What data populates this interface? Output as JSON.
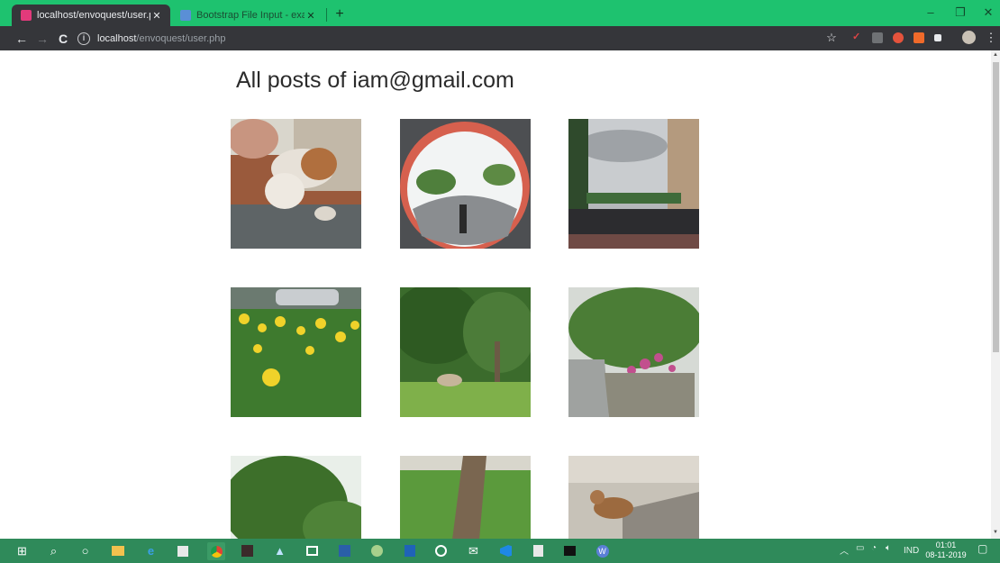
{
  "browser": {
    "tabs": [
      {
        "label": "localhost/envoquest/user.php",
        "favicon": "envoquest-favicon",
        "active": true
      },
      {
        "label": "Bootstrap File Input - examples",
        "favicon": "bootstrap-favicon",
        "active": false
      }
    ],
    "address": {
      "host": "localhost",
      "path": "/envoquest/user.php"
    }
  },
  "page": {
    "heading": "All posts of iam@gmail.com"
  },
  "taskbar": {
    "tray": {
      "language": "IND",
      "time": "01:01",
      "date": "08-11-2019"
    }
  },
  "colors": {
    "tab_strip": "#1ec26f",
    "toolbar": "#35363a",
    "taskbar": "#2f8a5a",
    "page_bg": "#ffffff"
  }
}
